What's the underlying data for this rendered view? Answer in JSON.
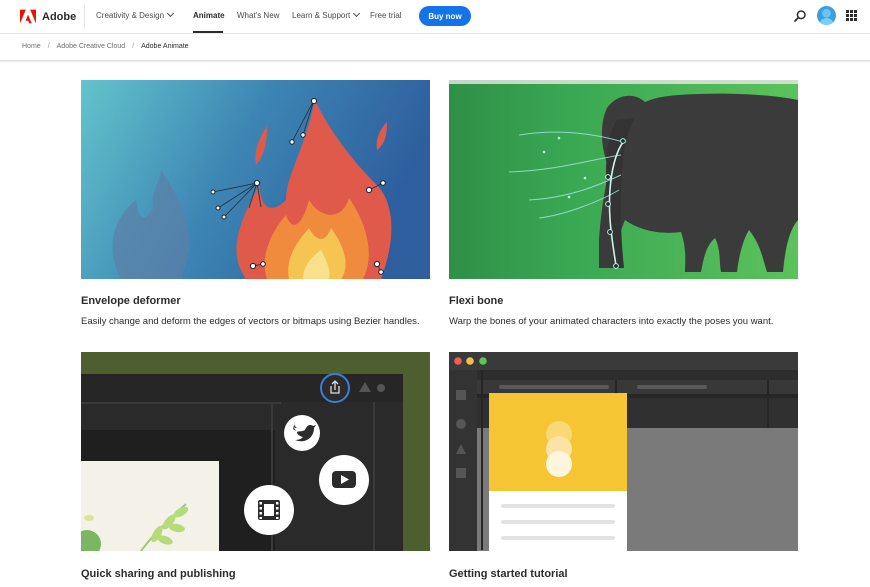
{
  "brand": {
    "name": "Adobe",
    "color": "#eb1000"
  },
  "nav": {
    "items": [
      {
        "label": "Creativity & Design",
        "dropdown": true
      },
      {
        "label": "Animate",
        "active": true
      },
      {
        "label": "What's New"
      },
      {
        "label": "Learn & Support",
        "dropdown": true
      },
      {
        "label": "Free trial"
      }
    ],
    "buy_label": "Buy now",
    "accent": "#1473e6",
    "icons": [
      "search-icon",
      "avatar",
      "app-switcher-icon"
    ]
  },
  "breadcrumb": [
    "Home",
    "Adobe Creative Cloud",
    "Adobe Animate"
  ],
  "features": [
    {
      "title": "Envelope deformer",
      "description": "Easily change and deform the edges of vectors or bitmaps using Bezier handles."
    },
    {
      "title": "Flexi bone",
      "description": "Warp the bones of your animated characters into exactly the poses you want."
    },
    {
      "title": "Quick sharing and publishing",
      "description": ""
    },
    {
      "title": "Getting started tutorial",
      "description": ""
    }
  ]
}
